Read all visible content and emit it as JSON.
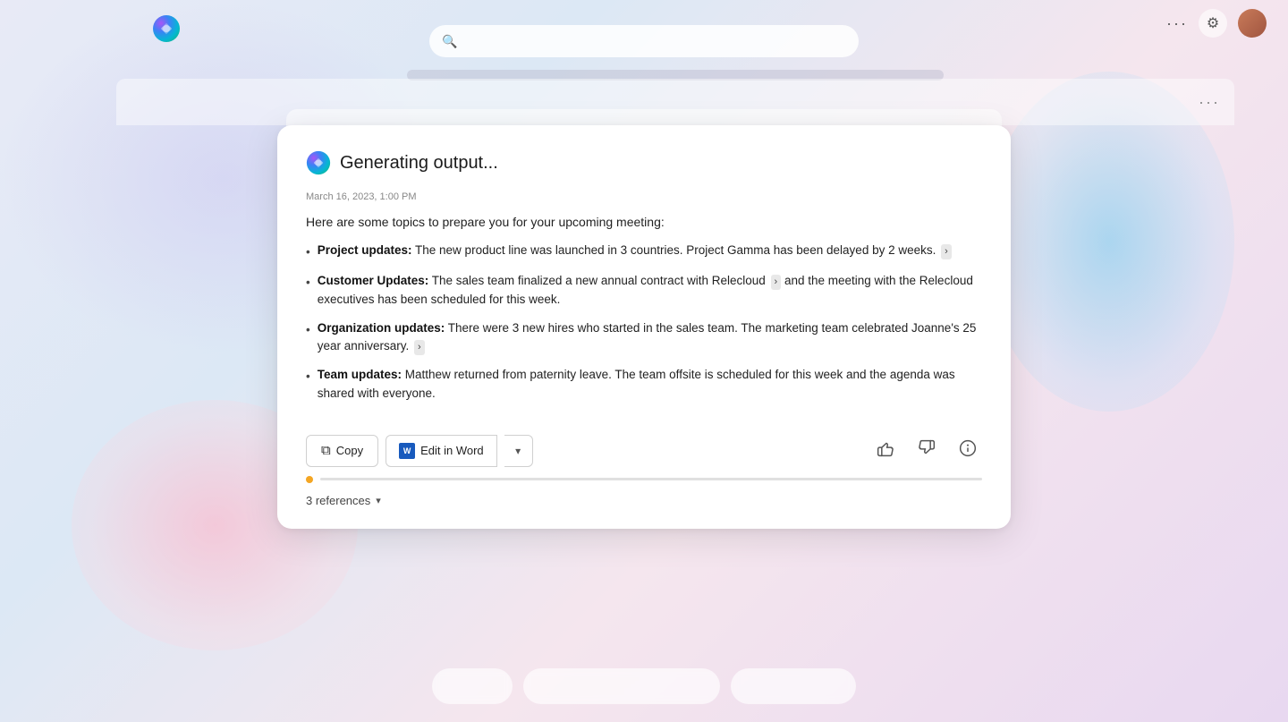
{
  "app": {
    "title": "Microsoft Copilot",
    "logo_label": "Copilot"
  },
  "topbar": {
    "dots_label": "···",
    "gear_label": "⚙",
    "more_options": "More options"
  },
  "search": {
    "placeholder": ""
  },
  "doc_panel": {
    "dots": "···"
  },
  "card": {
    "status": "Generating output...",
    "timestamp": "March 16, 2023, 1:00 PM",
    "intro": "Here are some topics to prepare you for your upcoming meeting:",
    "bullets": [
      {
        "label": "Project updates:",
        "text": " The new product line was launched in 3 countries. Project Gamma has been delayed by 2 weeks.",
        "has_ref": true
      },
      {
        "label": "Customer Updates:",
        "text": " The sales team finalized a new annual contract with Relecloud",
        "text2": " and the meeting with the Relecloud executives has been scheduled for this week.",
        "has_ref": true
      },
      {
        "label": "Organization updates:",
        "text": " There were 3 new hires who started in the sales team. The marketing team celebrated Joanne's 25 year anniversary.",
        "has_ref": true
      },
      {
        "label": "Team updates:",
        "text": " Matthew returned from paternity leave. The team offsite is scheduled for this week and the agenda was shared with everyone.",
        "has_ref": false
      }
    ],
    "copy_label": "Copy",
    "edit_word_label": "Edit in Word",
    "references_label": "3 references",
    "feedback": {
      "thumbs_up": "👍",
      "thumbs_down": "👎",
      "info": "ℹ"
    }
  },
  "suggestions": [
    {
      "label": ""
    },
    {
      "label": ""
    },
    {
      "label": ""
    }
  ],
  "colors": {
    "accent_orange": "#f4a623",
    "word_blue": "#185ABD",
    "text_primary": "#1a1a1a",
    "text_secondary": "#888888"
  }
}
